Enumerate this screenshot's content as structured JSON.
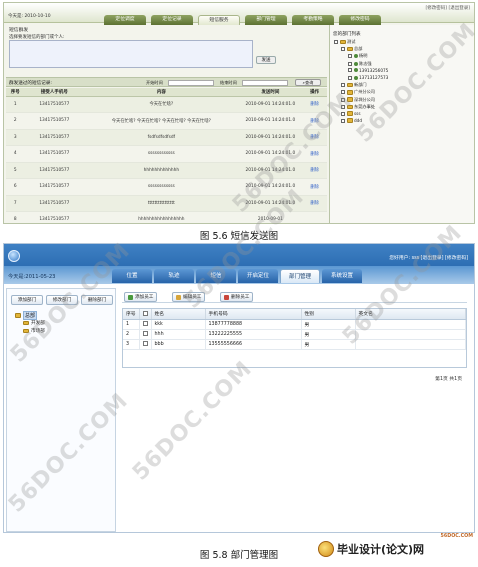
{
  "shot1": {
    "toplinks": "[修改密码] [退出登录]",
    "date": "今天是: 2010-10-10",
    "tabs": [
      "定位调度",
      "定位记录",
      "短信服务",
      "部门管理",
      "考勤策略",
      "修改密码"
    ],
    "active_tab": 2,
    "send_title": "短信群发",
    "send_label": "选择要发短信的部门或个人:",
    "send_button": "发送",
    "record_title": "群发送过的短信记录:",
    "start_label": "开始时间",
    "end_label": "结束时间",
    "query_button": "查询",
    "table_headers": [
      "序号",
      "接受人手机号",
      "内容",
      "发送时间",
      "操作"
    ],
    "rows": [
      {
        "no": "1",
        "phone": "13417510577",
        "content": "今天在忙啥?",
        "time": "2010-09-01 14:24:01.0",
        "op": "删除"
      },
      {
        "no": "2",
        "phone": "13417510577",
        "content": "今天在忙啥? 今天在忙啥? 今天在忙啥? 今天在忙啥?",
        "time": "2010-09-01 14:24:01.0",
        "op": "删除"
      },
      {
        "no": "3",
        "phone": "13417510577",
        "content": "fsdfsdfsdfsdf",
        "time": "2010-09-01 14:24:01.0",
        "op": "删除"
      },
      {
        "no": "4",
        "phone": "13417510577",
        "content": "ssssssssssss",
        "time": "2010-09-01 14:24:01.0",
        "op": "删除"
      },
      {
        "no": "5",
        "phone": "13417510577",
        "content": "hhhhhhhhhhhhh",
        "time": "2010-09-01 14:24:01.0",
        "op": "删除"
      },
      {
        "no": "6",
        "phone": "13417510577",
        "content": "ssssssssssss",
        "time": "2010-09-01 14:24:01.0",
        "op": "删除"
      },
      {
        "no": "7",
        "phone": "13417510577",
        "content": "tttttttttttttttt",
        "time": "2010-09-01 14:24:01.0",
        "op": "删除"
      },
      {
        "no": "8",
        "phone": "13417510577",
        "content": "hhhhhhhhhhhhhhhhh",
        "time": "2010-09-01",
        "op": ""
      }
    ],
    "right_title": "您的部门列表",
    "tree": [
      {
        "label": "测试",
        "level": 0,
        "type": "folder"
      },
      {
        "label": "总部",
        "level": 1,
        "type": "folder"
      },
      {
        "label": "杨明",
        "level": 2,
        "type": "leaf"
      },
      {
        "label": "陈志强",
        "level": 2,
        "type": "leaf"
      },
      {
        "label": "13913256075",
        "level": 2,
        "type": "leaf"
      },
      {
        "label": "13713127573",
        "level": 2,
        "type": "leaf"
      },
      {
        "label": "新部门",
        "level": 1,
        "type": "folder"
      },
      {
        "label": "广州分公司",
        "level": 1,
        "type": "folder"
      },
      {
        "label": "深圳分公司",
        "level": 1,
        "type": "folder"
      },
      {
        "label": "东莞办事处",
        "level": 1,
        "type": "folder"
      },
      {
        "label": "sss",
        "level": 1,
        "type": "folder"
      },
      {
        "label": "ddd",
        "level": 1,
        "type": "folder"
      }
    ]
  },
  "caption1": "图 5.6  短信发送图",
  "shot2": {
    "toplinks": "您好用户: sss [退出登录] [修改密码]",
    "date": "今天是:2011-05-23",
    "tabs": [
      "位置",
      "轨迹",
      "短信",
      "开启定位",
      "部门管理",
      "系统设置"
    ],
    "active_tab": 4,
    "left_buttons": [
      "添加部门",
      "修改部门",
      "删除部门"
    ],
    "tree_root": "总部",
    "tree_children": [
      "开发部",
      "市场部"
    ],
    "toolbar": [
      "添加员工",
      "编辑员工",
      "删除员工"
    ],
    "table_headers": [
      "序号",
      "",
      "姓名",
      "手机号码",
      "性别",
      "英文名"
    ],
    "rows": [
      {
        "no": "1",
        "name": "kkk",
        "phone": "13877778888",
        "sex": "男",
        "en": ""
      },
      {
        "no": "2",
        "name": "hhh",
        "phone": "13222225555",
        "sex": "男",
        "en": ""
      },
      {
        "no": "3",
        "name": "bbb",
        "phone": "13555556666",
        "sex": "男",
        "en": ""
      }
    ],
    "pager": "第1页 共1页"
  },
  "caption2": "图 5.8  部门管理图",
  "bottom_site": "56DOC.COM",
  "watermark": "56DOC.COM",
  "logo_text": "毕业设计(论文)网",
  "colors": {
    "shot1_accent": "#6b7f3f",
    "shot2_accent": "#2763a8",
    "link": "#2c5dc7"
  }
}
